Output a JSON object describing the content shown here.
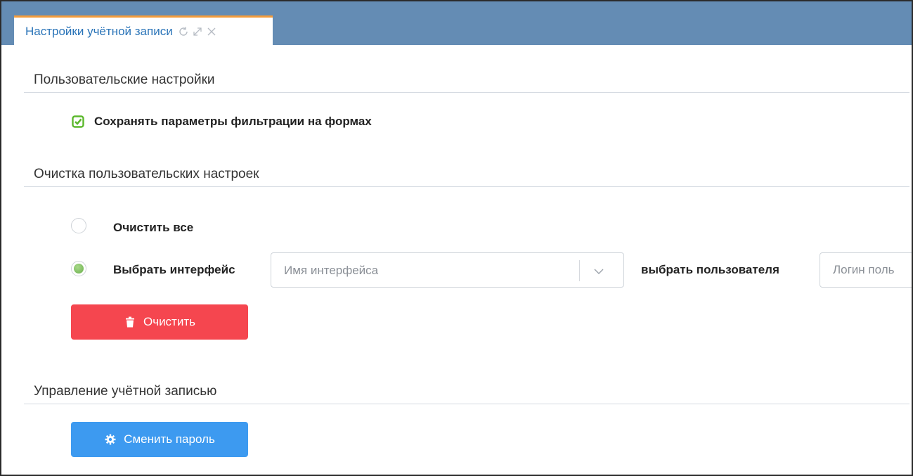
{
  "tab": {
    "title": "Настройки учётной записи",
    "icons": [
      "refresh-icon",
      "expand-icon",
      "close-icon"
    ]
  },
  "sections": {
    "user_settings": {
      "title": "Пользовательские настройки",
      "save_filter_label": "Сохранять параметры фильтрации на формах",
      "save_filter_checked": true
    },
    "clear_settings": {
      "title": "Очистка пользовательских настроек",
      "clear_all_label": "Очистить все",
      "clear_all_selected": false,
      "select_interface_label": "Выбрать интерфейс",
      "select_interface_selected": true,
      "interface_placeholder": "Имя интерфейса",
      "select_user_label": "выбрать пользователя",
      "login_placeholder": "Логин поль",
      "clear_button_label": "Очистить"
    },
    "account": {
      "title": "Управление учётной записью",
      "change_password_label": "Сменить пароль"
    }
  },
  "colors": {
    "tabbar": "#648cb4",
    "tab_accent": "#f39c3c",
    "checkbox_green": "#5cb82d",
    "danger": "#f5464f",
    "primary": "#3d9af0"
  }
}
